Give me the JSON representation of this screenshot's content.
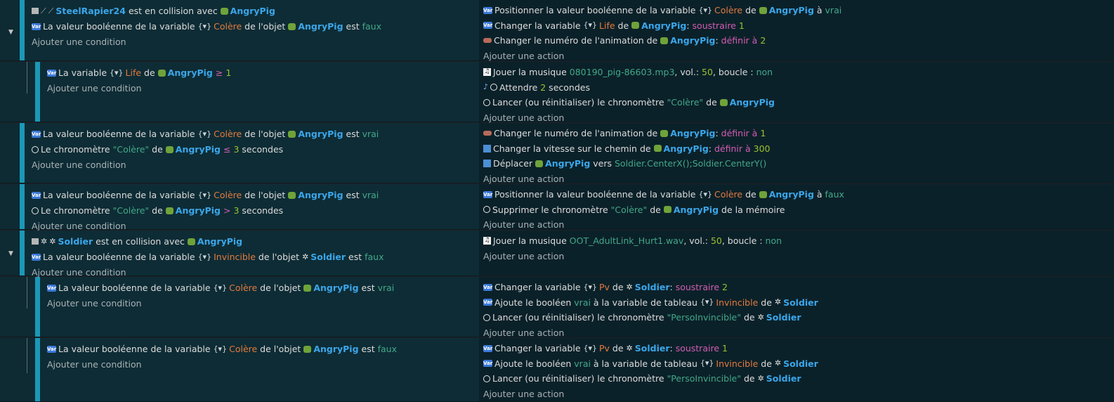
{
  "colors": {
    "rail": "#1b98b7",
    "object": "#3ba6ea",
    "variable": "#e27a3f",
    "value": "#43a98c",
    "number": "#9bc22d",
    "operation": "#d35db3"
  },
  "add_condition": "Ajouter une condition",
  "add_action": "Ajouter une action",
  "events": [
    {
      "conditions": [
        [
          "SteelRapier24",
          " est en collision avec ",
          "AngryPig"
        ],
        [
          "La valeur booléenne de la variable ",
          "Colère",
          " de l'objet ",
          "AngryPig",
          " est ",
          "faux"
        ]
      ],
      "actions": [
        [
          "Positionner la valeur booléenne de la variable ",
          "Colère",
          " de ",
          "AngryPig",
          " à ",
          "vrai"
        ],
        [
          "Changer la variable ",
          "Life",
          " de ",
          "AngryPig",
          ": ",
          "soustraire",
          " ",
          "1"
        ],
        [
          "Changer le numéro de l'animation de ",
          "AngryPig",
          ": ",
          "définir à",
          " ",
          "2"
        ]
      ]
    },
    {
      "conditions": [
        [
          "La variable ",
          "Life",
          " de ",
          "AngryPig",
          " ",
          "≥",
          " ",
          "1"
        ]
      ],
      "actions": [
        [
          "Jouer la musique ",
          "080190_pig-86603.mp3",
          ", vol.: ",
          "50",
          ", boucle : ",
          "non"
        ],
        [
          "Attendre ",
          "2",
          " secondes"
        ],
        [
          "Lancer (ou réinitialiser) le chronomètre ",
          "\"Colère\"",
          " de ",
          "AngryPig"
        ]
      ]
    },
    {
      "conditions": [
        [
          "La valeur booléenne de la variable ",
          "Colère",
          " de l'objet ",
          "AngryPig",
          " est ",
          "vrai"
        ],
        [
          "Le chronomètre ",
          "\"Colère\"",
          " de ",
          "AngryPig",
          " ",
          "≤",
          " ",
          "3",
          " secondes"
        ]
      ],
      "actions": [
        [
          "Changer le numéro de l'animation de ",
          "AngryPig",
          ": ",
          "définir à",
          " ",
          "1"
        ],
        [
          "Changer la vitesse sur le chemin de ",
          "AngryPig",
          ": ",
          "définir à",
          " ",
          "300"
        ],
        [
          "Déplacer ",
          "AngryPig",
          " vers ",
          "Soldier.CenterX();Soldier.CenterY()"
        ]
      ]
    },
    {
      "conditions": [
        [
          "La valeur booléenne de la variable ",
          "Colère",
          " de l'objet ",
          "AngryPig",
          " est ",
          "vrai"
        ],
        [
          "Le chronomètre ",
          "\"Colère\"",
          " de ",
          "AngryPig",
          " ",
          ">",
          " ",
          "3",
          " secondes"
        ]
      ],
      "actions": [
        [
          "Positionner la valeur booléenne de la variable ",
          "Colère",
          " de ",
          "AngryPig",
          " à ",
          "faux"
        ],
        [
          "Supprimer le chronomètre ",
          "\"Colère\"",
          " de ",
          "AngryPig",
          " de la mémoire"
        ]
      ]
    },
    {
      "conditions": [
        [
          "Soldier",
          " est en collision avec ",
          "AngryPig"
        ],
        [
          "La valeur booléenne de la variable ",
          "Invincible",
          " de l'objet ",
          "Soldier",
          " est ",
          "faux"
        ]
      ],
      "actions": [
        [
          "Jouer la musique ",
          "OOT_AdultLink_Hurt1.wav",
          ", vol.: ",
          "50",
          ", boucle : ",
          "non"
        ]
      ]
    },
    {
      "conditions": [
        [
          "La valeur booléenne de la variable ",
          "Colère",
          " de l'objet ",
          "AngryPig",
          " est ",
          "vrai"
        ]
      ],
      "actions": [
        [
          "Changer la variable ",
          "Pv",
          " de ",
          "Soldier",
          ": ",
          "soustraire",
          " ",
          "2"
        ],
        [
          "Ajoute le booléen ",
          "vrai",
          " à la variable de tableau ",
          "Invincible",
          " de ",
          "Soldier"
        ],
        [
          "Lancer (ou réinitialiser) le chronomètre ",
          "\"PersoInvincible\"",
          " de ",
          "Soldier"
        ]
      ]
    },
    {
      "conditions": [
        [
          "La valeur booléenne de la variable ",
          "Colère",
          " de l'objet ",
          "AngryPig",
          " est ",
          "faux"
        ]
      ],
      "actions": [
        [
          "Changer la variable ",
          "Pv",
          " de ",
          "Soldier",
          ": ",
          "soustraire",
          " ",
          "1"
        ],
        [
          "Ajoute le booléen ",
          "vrai",
          " à la variable de tableau ",
          "Invincible",
          " de ",
          "Soldier"
        ],
        [
          "Lancer (ou réinitialiser) le chronomètre ",
          "\"PersoInvincible\"",
          " de ",
          "Soldier"
        ]
      ]
    }
  ]
}
